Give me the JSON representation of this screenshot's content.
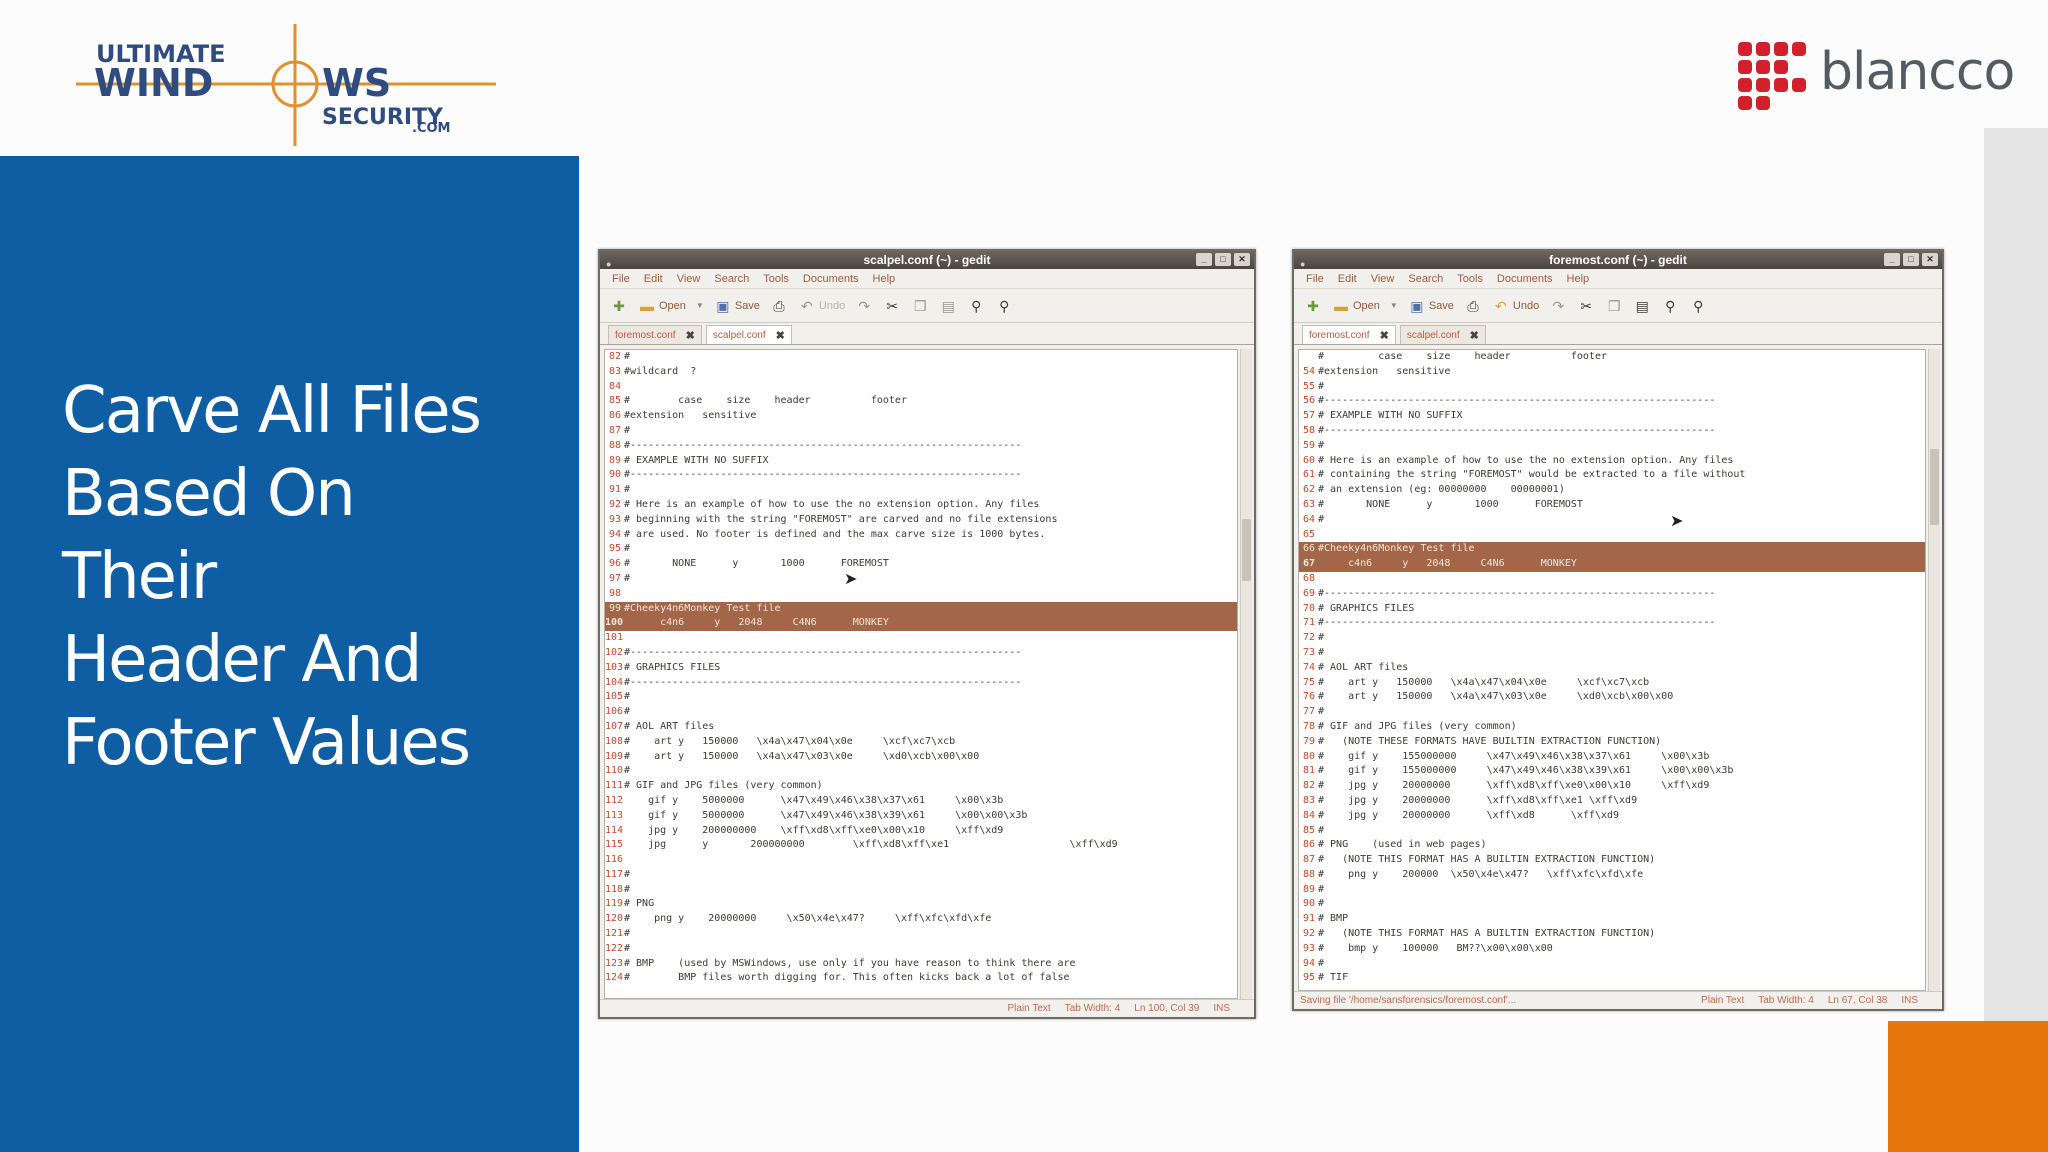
{
  "slide": {
    "title_lines": [
      "Carve All Files",
      "Based On",
      "Their",
      "Header And",
      "Footer Values"
    ],
    "colors": {
      "panel_blue": "#0f5ea3",
      "orange": "#e8760f",
      "highlight": "#a36649"
    }
  },
  "logos": {
    "uws": {
      "line1": "ULTIMATE",
      "line2a": "WIND",
      "line2b": "WS",
      "line3": "SECURITY",
      "line4": ".COM"
    },
    "blancco": {
      "word": "blancco"
    }
  },
  "left_window": {
    "title": "scalpel.conf (~) - gedit",
    "menu": [
      "File",
      "Edit",
      "View",
      "Search",
      "Tools",
      "Documents",
      "Help"
    ],
    "toolbar": {
      "open": "Open",
      "save": "Save",
      "undo": "Undo"
    },
    "tabs": [
      {
        "label": "foremost.conf",
        "active": false
      },
      {
        "label": "scalpel.conf",
        "active": true
      }
    ],
    "lines": [
      {
        "n": "82",
        "t": "#"
      },
      {
        "n": "83",
        "t": "#wildcard  ?"
      },
      {
        "n": "84",
        "t": ""
      },
      {
        "n": "85",
        "t": "#        case    size    header          footer"
      },
      {
        "n": "86",
        "t": "#extension   sensitive"
      },
      {
        "n": "87",
        "t": "#"
      },
      {
        "n": "88",
        "t": "#-----------------------------------------------------------------"
      },
      {
        "n": "89",
        "t": "# EXAMPLE WITH NO SUFFIX"
      },
      {
        "n": "90",
        "t": "#-----------------------------------------------------------------"
      },
      {
        "n": "91",
        "t": "#"
      },
      {
        "n": "92",
        "t": "# Here is an example of how to use the no extension option. Any files"
      },
      {
        "n": "93",
        "t": "# beginning with the string \"FOREMOST\" are carved and no file extensions"
      },
      {
        "n": "94",
        "t": "# are used. No footer is defined and the max carve size is 1000 bytes."
      },
      {
        "n": "95",
        "t": "#"
      },
      {
        "n": "96",
        "t": "#       NONE      y       1000      FOREMOST"
      },
      {
        "n": "97",
        "t": "#"
      },
      {
        "n": "98",
        "t": ""
      },
      {
        "n": "99",
        "t": "#Cheeky4n6Monkey Test file",
        "hl": true
      },
      {
        "n": "100",
        "t": "      c4n6     y   2048     C4N6      MONKEY",
        "cur": true
      },
      {
        "n": "101",
        "t": ""
      },
      {
        "n": "102",
        "t": "#-----------------------------------------------------------------"
      },
      {
        "n": "103",
        "t": "# GRAPHICS FILES"
      },
      {
        "n": "104",
        "t": "#-----------------------------------------------------------------"
      },
      {
        "n": "105",
        "t": "#"
      },
      {
        "n": "106",
        "t": "#"
      },
      {
        "n": "107",
        "t": "# AOL ART files"
      },
      {
        "n": "108",
        "t": "#    art y   150000   \\x4a\\x47\\x04\\x0e     \\xcf\\xc7\\xcb"
      },
      {
        "n": "109",
        "t": "#    art y   150000   \\x4a\\x47\\x03\\x0e     \\xd0\\xcb\\x00\\x00"
      },
      {
        "n": "110",
        "t": "#"
      },
      {
        "n": "111",
        "t": "# GIF and JPG files (very common)"
      },
      {
        "n": "112",
        "t": "    gif y    5000000      \\x47\\x49\\x46\\x38\\x37\\x61     \\x00\\x3b"
      },
      {
        "n": "113",
        "t": "    gif y    5000000      \\x47\\x49\\x46\\x38\\x39\\x61     \\x00\\x00\\x3b"
      },
      {
        "n": "114",
        "t": "    jpg y    200000000    \\xff\\xd8\\xff\\xe0\\x00\\x10     \\xff\\xd9"
      },
      {
        "n": "115",
        "t": "    jpg      y       200000000        \\xff\\xd8\\xff\\xe1                    \\xff\\xd9"
      },
      {
        "n": "116",
        "t": ""
      },
      {
        "n": "117",
        "t": "#"
      },
      {
        "n": "118",
        "t": "#"
      },
      {
        "n": "119",
        "t": "# PNG"
      },
      {
        "n": "120",
        "t": "#    png y    20000000     \\x50\\x4e\\x47?     \\xff\\xfc\\xfd\\xfe"
      },
      {
        "n": "121",
        "t": "#"
      },
      {
        "n": "122",
        "t": "#"
      },
      {
        "n": "123",
        "t": "# BMP    (used by MSWindows, use only if you have reason to think there are"
      },
      {
        "n": "124",
        "t": "#        BMP files worth digging for. This often kicks back a lot of false"
      }
    ],
    "status": {
      "message": "",
      "lang": "Plain Text",
      "tab_width": "Tab Width:  4",
      "position": "Ln 100, Col 39",
      "mode": "INS"
    }
  },
  "right_window": {
    "title": "foremost.conf (~) - gedit",
    "menu": [
      "File",
      "Edit",
      "View",
      "Search",
      "Tools",
      "Documents",
      "Help"
    ],
    "toolbar": {
      "open": "Open",
      "save": "Save",
      "undo": "Undo"
    },
    "tabs": [
      {
        "label": "foremost.conf",
        "active": true
      },
      {
        "label": "scalpel.conf",
        "active": false
      }
    ],
    "lines": [
      {
        "n": "",
        "t": "#         case    size    header          footer"
      },
      {
        "n": "54",
        "t": "#extension   sensitive"
      },
      {
        "n": "55",
        "t": "#"
      },
      {
        "n": "56",
        "t": "#-----------------------------------------------------------------"
      },
      {
        "n": "57",
        "t": "# EXAMPLE WITH NO SUFFIX"
      },
      {
        "n": "58",
        "t": "#-----------------------------------------------------------------"
      },
      {
        "n": "59",
        "t": "#"
      },
      {
        "n": "60",
        "t": "# Here is an example of how to use the no extension option. Any files"
      },
      {
        "n": "61",
        "t": "# containing the string \"FOREMOST\" would be extracted to a file without"
      },
      {
        "n": "62",
        "t": "# an extension (eg: 00000000    00000001)"
      },
      {
        "n": "63",
        "t": "#       NONE      y       1000      FOREMOST"
      },
      {
        "n": "64",
        "t": "#"
      },
      {
        "n": "65",
        "t": ""
      },
      {
        "n": "66",
        "t": "#Cheeky4n6Monkey Test file",
        "hl": true
      },
      {
        "n": "67",
        "t": "     c4n6     y   2048     C4N6      MONKEY",
        "cur": true
      },
      {
        "n": "68",
        "t": ""
      },
      {
        "n": "69",
        "t": "#-----------------------------------------------------------------"
      },
      {
        "n": "70",
        "t": "# GRAPHICS FILES"
      },
      {
        "n": "71",
        "t": "#-----------------------------------------------------------------"
      },
      {
        "n": "72",
        "t": "#"
      },
      {
        "n": "73",
        "t": "#"
      },
      {
        "n": "74",
        "t": "# AOL ART files"
      },
      {
        "n": "75",
        "t": "#    art y   150000   \\x4a\\x47\\x04\\x0e     \\xcf\\xc7\\xcb"
      },
      {
        "n": "76",
        "t": "#    art y   150000   \\x4a\\x47\\x03\\x0e     \\xd0\\xcb\\x00\\x00"
      },
      {
        "n": "77",
        "t": "#"
      },
      {
        "n": "78",
        "t": "# GIF and JPG files (very common)"
      },
      {
        "n": "79",
        "t": "#   (NOTE THESE FORMATS HAVE BUILTIN EXTRACTION FUNCTION)"
      },
      {
        "n": "80",
        "t": "#    gif y    155000000     \\x47\\x49\\x46\\x38\\x37\\x61     \\x00\\x3b"
      },
      {
        "n": "81",
        "t": "#    gif y    155000000     \\x47\\x49\\x46\\x38\\x39\\x61     \\x00\\x00\\x3b"
      },
      {
        "n": "82",
        "t": "#    jpg y    20000000      \\xff\\xd8\\xff\\xe0\\x00\\x10     \\xff\\xd9"
      },
      {
        "n": "83",
        "t": "#    jpg y    20000000      \\xff\\xd8\\xff\\xe1 \\xff\\xd9"
      },
      {
        "n": "84",
        "t": "#    jpg y    20000000      \\xff\\xd8      \\xff\\xd9"
      },
      {
        "n": "85",
        "t": "#"
      },
      {
        "n": "86",
        "t": "# PNG    (used in web pages)"
      },
      {
        "n": "87",
        "t": "#   (NOTE THIS FORMAT HAS A BUILTIN EXTRACTION FUNCTION)"
      },
      {
        "n": "88",
        "t": "#    png y    200000  \\x50\\x4e\\x47?   \\xff\\xfc\\xfd\\xfe"
      },
      {
        "n": "89",
        "t": "#"
      },
      {
        "n": "90",
        "t": "#"
      },
      {
        "n": "91",
        "t": "# BMP"
      },
      {
        "n": "92",
        "t": "#   (NOTE THIS FORMAT HAS A BUILTIN EXTRACTION FUNCTION)"
      },
      {
        "n": "93",
        "t": "#    bmp y    100000   BM??\\x00\\x00\\x00"
      },
      {
        "n": "94",
        "t": "#"
      },
      {
        "n": "95",
        "t": "# TIF"
      }
    ],
    "status": {
      "message": "Saving file '/home/sansforensics/foremost.conf'...",
      "lang": "Plain Text",
      "tab_width": "Tab Width:  4",
      "position": "Ln 67, Col 38",
      "mode": "INS"
    }
  }
}
